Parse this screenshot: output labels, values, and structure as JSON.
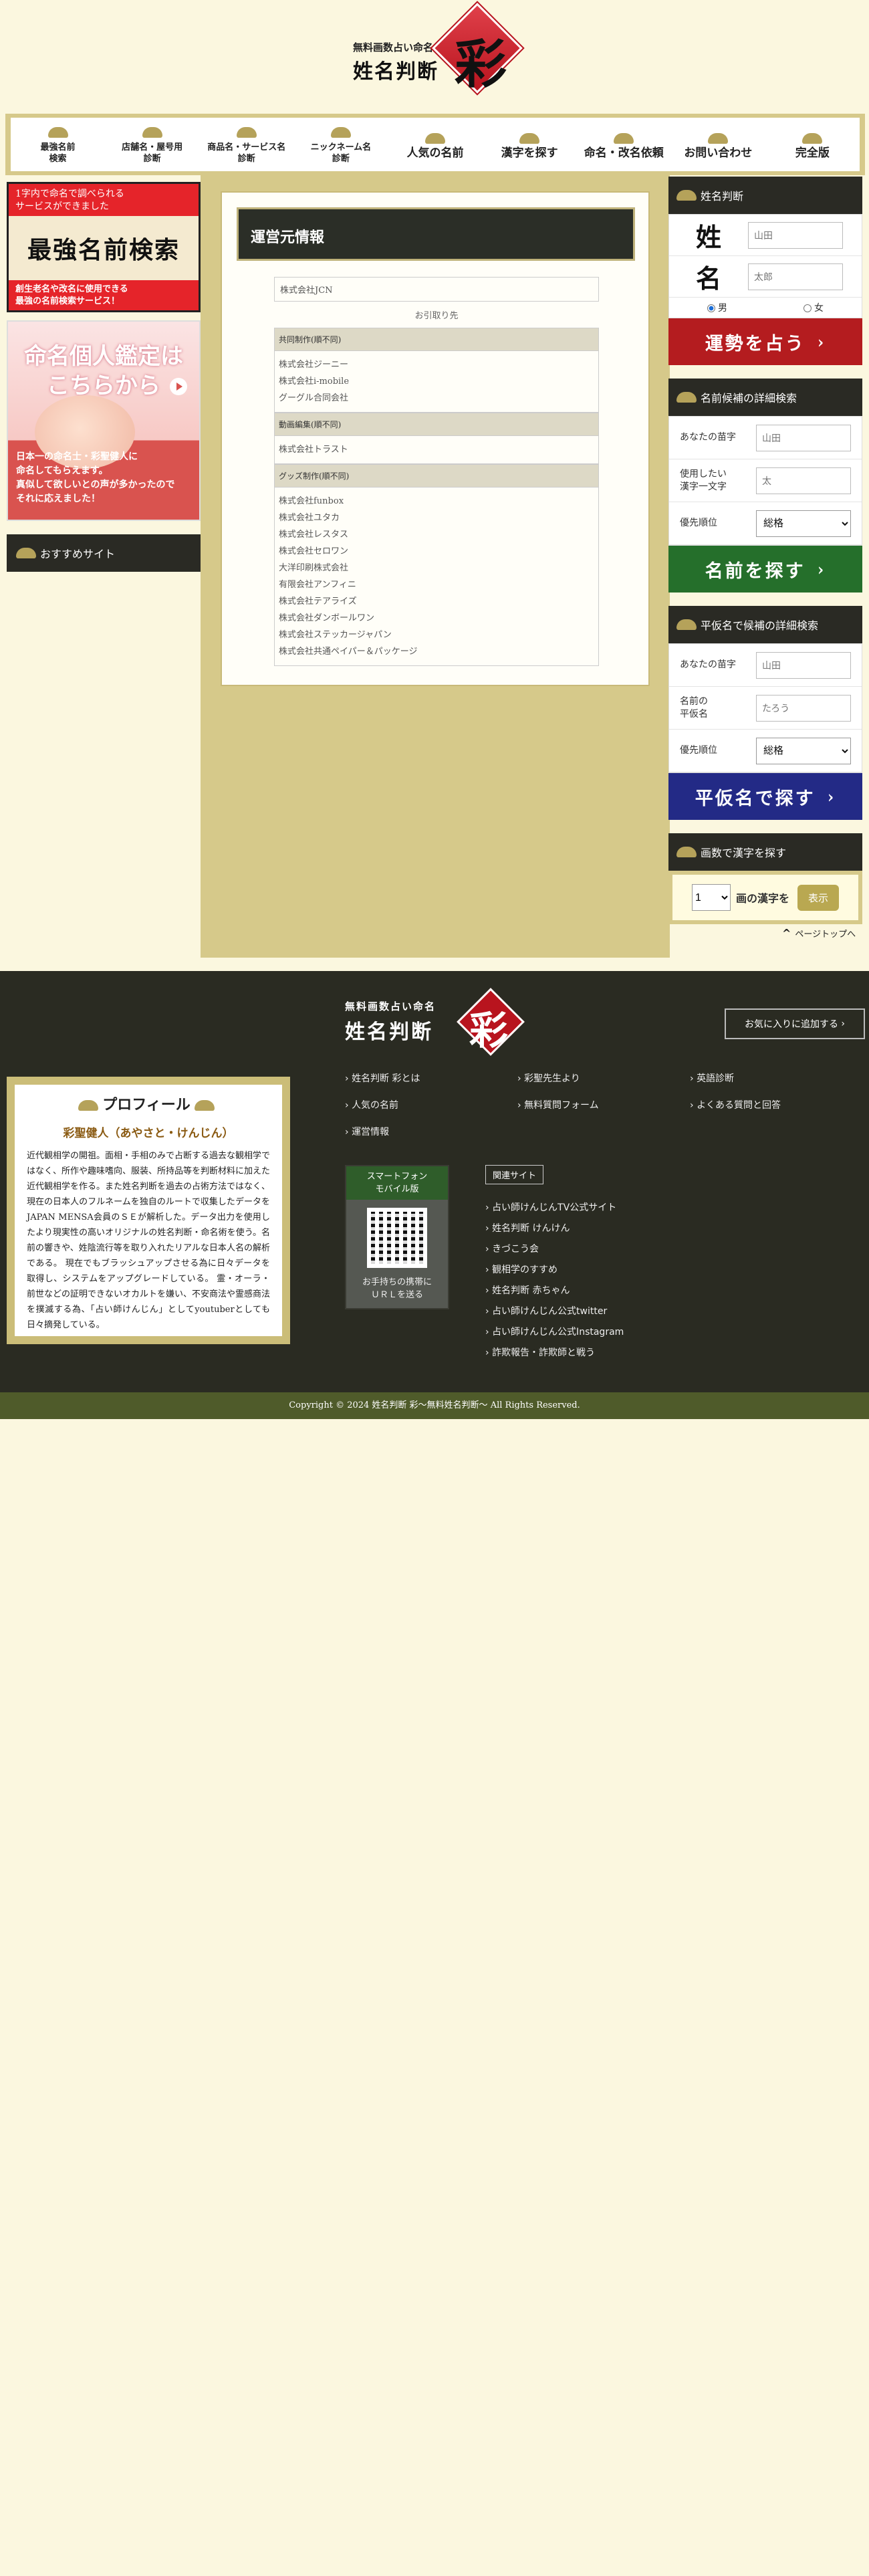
{
  "header": {
    "logo_sub": "無料画数占い命名",
    "logo_main": "姓名判断",
    "logo_ai": "彩"
  },
  "nav": {
    "items": [
      {
        "label": "最強名前\n検索"
      },
      {
        "label": "店舗名・屋号用\n診断"
      },
      {
        "label": "商品名・サービス名\n診断"
      },
      {
        "label": "ニックネーム名\n診断"
      },
      {
        "label": "人気の名前"
      },
      {
        "label": "漢字を探す"
      },
      {
        "label": "命名・改名依頼"
      },
      {
        "label": "お問い合わせ"
      },
      {
        "label": "完全版"
      }
    ]
  },
  "left": {
    "banner1_top": "1字内で命名で調べられる\nサービスができました",
    "banner1_mid": "最強名前検索",
    "banner1_bot": "創生老名や改名に使用できる\n最強の名前検索サービス！",
    "banner2_head": "命名個人鑑定は\nこちらから",
    "banner2_text": "日本一の命名士・彩聖健人に\n命名してもらえます。\n真似して欲しいとの声が多かったので\nそれに応えました！",
    "recommend": "おすすめサイト"
  },
  "main": {
    "title": "運営元情報",
    "company": "株式会社JCN",
    "omit": "お引取り先",
    "sections": [
      {
        "head": "共同制作(順不同)",
        "items": [
          "株式会社ジーニー",
          "株式会社i-mobile",
          "グーグル合同会社"
        ]
      },
      {
        "head": "動画編集(順不同)",
        "items": [
          "株式会社トラスト"
        ]
      },
      {
        "head": "グッズ制作(順不同)",
        "items": [
          "株式会社funbox",
          "株式会社ユタカ",
          "株式会社レスタス",
          "株式会社セロワン",
          "大洋印刷株式会社",
          "有限会社アンフィニ",
          "株式会社テアライズ",
          "株式会社ダンボールワン",
          "株式会社ステッカージャパン",
          "株式会社共通ペイパー＆パッケージ"
        ]
      }
    ]
  },
  "right": {
    "seimei": {
      "title": "姓名判断",
      "sei_label": "姓",
      "mei_label": "名",
      "sei_placeholder": "山田",
      "mei_placeholder": "太郎",
      "male": "男",
      "female": "女",
      "button": "運勢を占う"
    },
    "detail": {
      "title": "名前候補の詳細検索",
      "surname_label": "あなたの苗字",
      "surname_placeholder": "山田",
      "kanji_label": "使用したい\n漢字一文字",
      "kanji_placeholder": "太",
      "priority_label": "優先順位",
      "priority_value": "総格",
      "button": "名前を探す"
    },
    "kana": {
      "title": "平仮名で候補の詳細検索",
      "surname_label": "あなたの苗字",
      "surname_placeholder": "山田",
      "kana_label": "名前の\n平仮名",
      "kana_placeholder": "たろう",
      "priority_label": "優先順位",
      "priority_value": "総格",
      "button": "平仮名で探す"
    },
    "strokes": {
      "title": "画数で漢字を探す",
      "value": "1",
      "suffix": "画の漢字を",
      "button": "表示"
    }
  },
  "pagetop": "ページトップへ",
  "footer": {
    "logo_sub": "無料画数占い命名",
    "logo_main": "姓名判断",
    "logo_ai": "彩",
    "favorite": "お気に入りに追加する",
    "profile_head": "プロフィール",
    "profile_name": "彩聖健人（あやさと・けんじん）",
    "profile_desc": "近代観相学の開祖。面相・手相のみで占断する過去な観相学ではなく、所作や趣味嗜向、服装、所持品等を判断材料に加えた近代観相学を作る。また姓名判断を過去の占術方法ではなく、現在の日本人のフルネームを独自のルートで収集したデータを JAPAN MENSA会員のＳＥが解析した。データ出力を使用したより現実性の高いオリジナルの姓名判断・命名術を使う。名前の響きや、姓陰流行等を取り入れたリアルな日本人名の解析である。 現在でもブラッシュアップさせる為に日々データを取得し、システムをアップグレードしている。 霊・オーラ・前世などの証明できないオカルトを嫌い、不安商法や霊感商法を撲滅する為、「占い師けんじん」としてyoutuberとしても日々摘発している。",
    "links": [
      "姓名判断 彩とは",
      "彩聖先生より",
      "英語診断",
      "人気の名前",
      "無料質問フォーム",
      "よくある質問と回答",
      "運営情報"
    ],
    "qr_head": "スマートフォン\nモバイル版",
    "qr_foot": "お手持ちの携帯に\nＵＲＬを送る",
    "related_tag": "関連サイト",
    "related": [
      "占い師けんじんTV公式サイト",
      "姓名判断 けんけん",
      "きづこう会",
      "観相学のすすめ",
      "姓名判断 赤ちゃん",
      "占い師けんじん公式twitter",
      "占い師けんじん公式Instagram",
      "詐欺報告・詐欺師と戦う"
    ]
  },
  "copyright": "Copyright © 2024 姓名判断 彩〜無料姓名判断〜 All Rights Reserved."
}
